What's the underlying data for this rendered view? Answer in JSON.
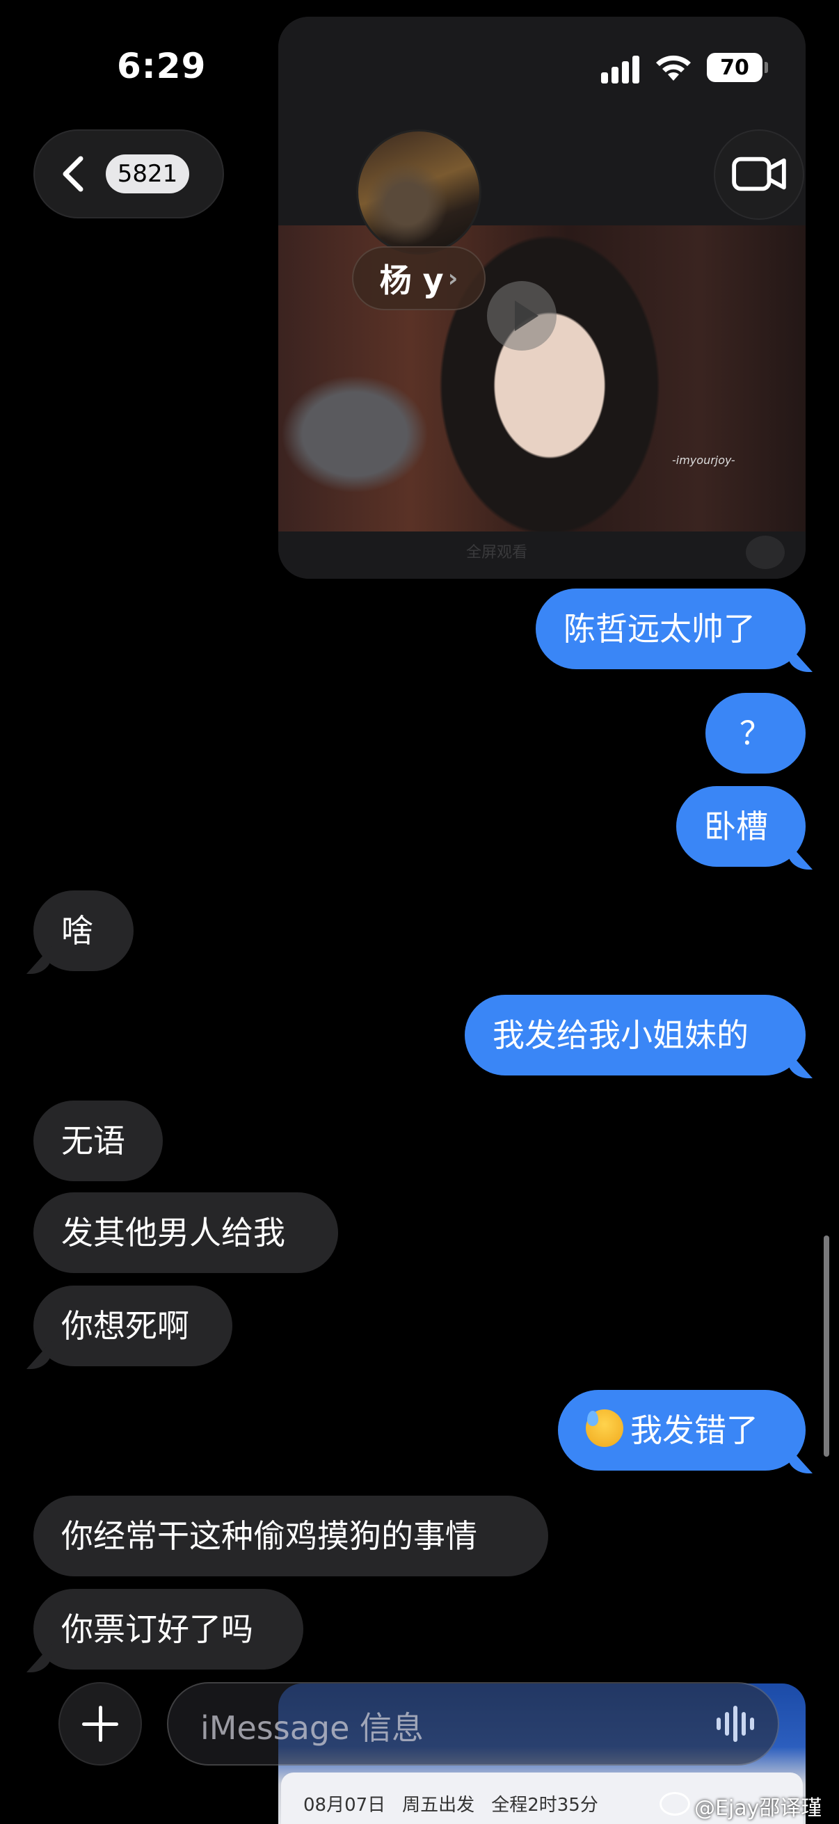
{
  "status_bar": {
    "time": "6:29",
    "battery": "70"
  },
  "header": {
    "back_badge": "5821",
    "contact_name": "杨 y"
  },
  "media": {
    "watermark": "-imyourjoy-",
    "fullscreen_label": "全屏观看"
  },
  "messages": [
    {
      "side": "out",
      "text": "陈哲远太帅了"
    },
    {
      "side": "out",
      "text": "？"
    },
    {
      "side": "out",
      "text": "卧槽"
    },
    {
      "side": "in",
      "text": "啥"
    },
    {
      "side": "out",
      "text": "我发给我小姐妹的"
    },
    {
      "side": "in",
      "text": "无语"
    },
    {
      "side": "in",
      "text": "发其他男人给我"
    },
    {
      "side": "in",
      "text": "你想死啊"
    },
    {
      "side": "out",
      "text": "我发错了",
      "emoji": "downcast-sweat-face"
    },
    {
      "side": "in",
      "text": "你经常干这种偷鸡摸狗的事情"
    },
    {
      "side": "in",
      "text": "你票订好了吗"
    }
  ],
  "input": {
    "placeholder": "iMessage 信息"
  },
  "overlay_app": {
    "trip_date": "08月07日",
    "trip_day": "周五出发",
    "trip_duration": "全程2时35分"
  },
  "watermark_credit": "@Ejay邵译瑾"
}
